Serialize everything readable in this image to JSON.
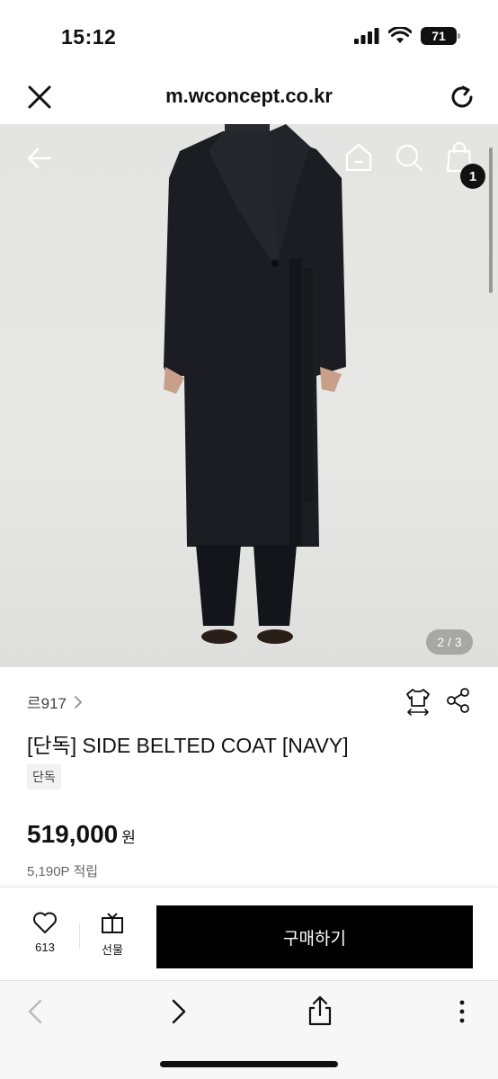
{
  "status": {
    "time": "15:12",
    "battery": "71"
  },
  "browser": {
    "url": "m.wconcept.co.kr"
  },
  "hero": {
    "cart_count": "1",
    "image_counter": "2 / 3"
  },
  "product": {
    "brand": "르917",
    "title": "[단독] SIDE BELTED COAT [NAVY]",
    "tag": "단독",
    "price": "519,000",
    "price_unit": "원",
    "points": "5,190P 적립"
  },
  "actions": {
    "like_count": "613",
    "gift_label": "선물",
    "buy_label": "구매하기"
  }
}
